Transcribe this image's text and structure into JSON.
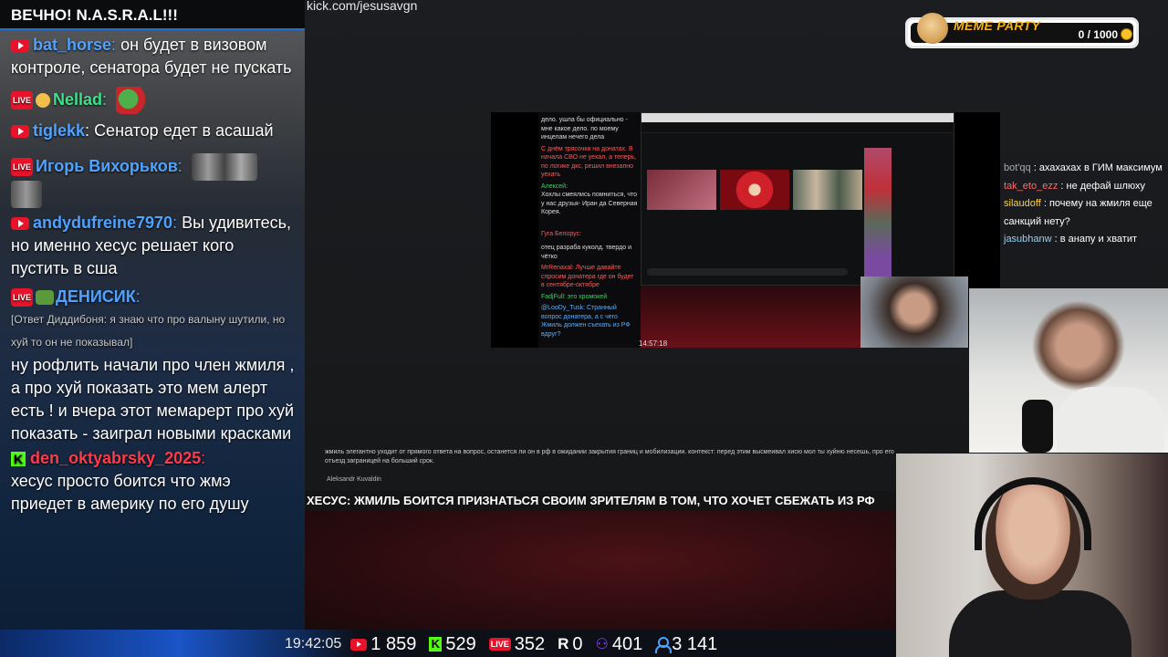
{
  "chat": {
    "header": "ВЕЧНО! N.A.S.R.A.L!!!",
    "messages": [
      {
        "platform": "youtube",
        "nick": "bat_horse",
        "nick_color": "#4fa3ff",
        "text": "он будет в визовом контроле, сенатора будет не пускать"
      },
      {
        "platform": "live",
        "nick": "Nellad",
        "nick_color": "#3fe08a",
        "text": ""
      },
      {
        "platform": "youtube",
        "nick": "tiglekk",
        "nick_color": "#4fa3ff",
        "text": "Сенатор едет в асашай"
      },
      {
        "platform": "live",
        "nick": "Игорь Вихорьков",
        "nick_color": "#4fa3ff",
        "text": ""
      },
      {
        "platform": "youtube",
        "nick": "andydufreine7970",
        "nick_color": "#4fa3ff",
        "text": "Вы удивитесь, но именно хесус решает кого пустить в сша"
      },
      {
        "platform": "live",
        "nick": "ДЕНИСИК",
        "nick_color": "#4fa3ff",
        "reply": "[Ответ Диддибоня: я знаю что про валыну шутили, но хуй то он не показывал]",
        "text": "ну рофлить начали про член жмиля , а  про хуй показать это мем алерт есть ! и вчера этот мемарерт про хуй показать - заиграл новыми красками"
      },
      {
        "platform": "kick",
        "nick": "den_oktyabrsky_2025",
        "nick_color": "#ff3a4a",
        "text": "хесус просто боится что жмэ приедет в америку по его душу"
      }
    ]
  },
  "url": "kick.com/jesusavgn",
  "meme_party": {
    "title": "MEME PARTY",
    "count": "0 / 1000"
  },
  "screen": {
    "chat_lines": [
      {
        "c": "",
        "t": "дело. ушла бы официально - мне какое дело. по моему инцелам нечего дела"
      },
      {
        "c": "r",
        "t": "С днём трясочки на донатах. В начала СВО не уехал, а теперь, по логике дкс, решил внезапно уехать"
      },
      {
        "c": "g",
        "t": "Алексей:"
      },
      {
        "c": "",
        "t": "Хохлы смеялись помниться, что у нас друзья- Иран да Северная Корея."
      },
      {
        "c": "r",
        "t": "Гуга Белорус:"
      },
      {
        "c": "",
        "t": "отец разраба куколд. твердо и чётко"
      },
      {
        "c": "r",
        "t": "MrRenaxal: Лучше давайте спросим донатера где он будет в сентябре-октябре"
      },
      {
        "c": "g",
        "t": "FadjFull: это хромокей"
      },
      {
        "c": "b",
        "t": "@LooDy_Tusk: Странный вопрос донатера, а с чего Жмиль должен съехать из РФ вдруг?"
      }
    ],
    "time": "14:57:18"
  },
  "side_chat": [
    {
      "user": "bot'qq",
      "cls": "u1",
      "text": "ахахахах в ГИМ максимум"
    },
    {
      "user": "tak_eto_ezz",
      "cls": "u2",
      "text": "не дефай шлюху"
    },
    {
      "user": "silaudoff",
      "cls": "u3",
      "text": "почему на жмиля еще санкций нету?"
    },
    {
      "user": "jasubhanw",
      "cls": "u4",
      "text": "в анапу и хватит"
    }
  ],
  "caption": {
    "text": "жмиль элегантно уходит от прямого ответа на вопрос, останется ли он в рф в ожидании закрытия границ и мобилизации. контекст: перед этим высмеивал хисю мол ты хуйню несешь, про его отъезд заграницей на больший срок.",
    "author": "Aleksandr Kuvaldin"
  },
  "headline": "ХЕСУС: ЖМИЛЬ БОИТСЯ ПРИЗНАТЬСЯ СВОИМ ЗРИТЕЛЯМ В ТОМ, ЧТО ХОЧЕТ СБЕЖАТЬ ИЗ РФ",
  "stats": {
    "time": "19:42:05",
    "youtube": "1 859",
    "kick": "529",
    "live": "352",
    "r": "0",
    "twitch": "401",
    "total": "3 141"
  },
  "colors": {
    "accent": "#1f6fd1",
    "youtube": "#e8132b",
    "kick": "#53fc18",
    "gold": "#f3b21b"
  }
}
